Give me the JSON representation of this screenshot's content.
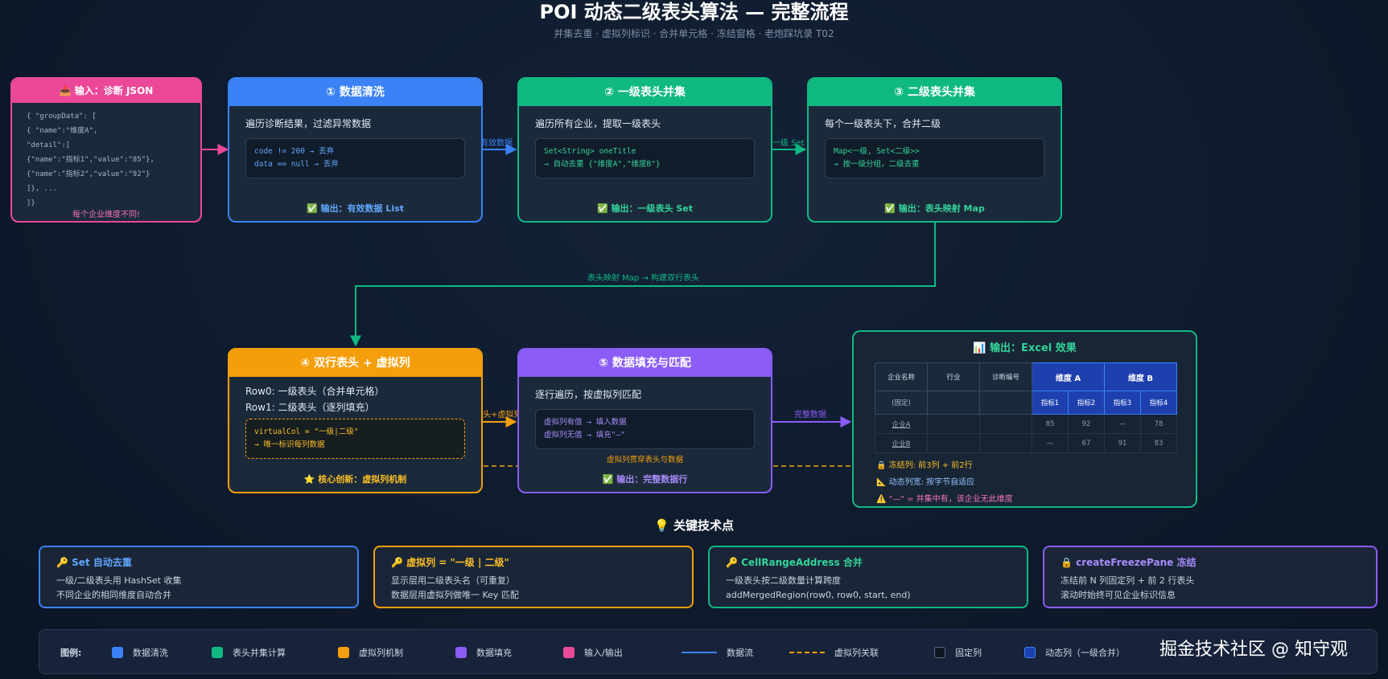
{
  "title": "POI 动态二级表头算法 — 完整流程",
  "subtitle": "并集去重 · 虚拟列标识 · 合并单元格 · 冻结窗格 · 老炮踩坑录 T02",
  "colors": {
    "pink": "#ec4899",
    "blue": "#3b82f6",
    "green": "#10b981",
    "orange": "#f59e0b",
    "purple": "#8b5cf6",
    "dark": "#0f1722",
    "navy": "#1e40af"
  },
  "input": {
    "title": "📥 输入：诊断 JSON",
    "lines": [
      "{ \"groupData\": [",
      "{ \"name\":\"维度A\",",
      "\"detail\":[",
      "{\"name\":\"指标1\",\"value\":\"85\"},",
      "{\"name\":\"指标2\",\"value\":\"92\"}",
      "]}, ...",
      "]}"
    ],
    "note": "每个企业维度不同!"
  },
  "step1": {
    "title": "① 数据清洗",
    "desc": "遍历诊断结果，过滤异常数据",
    "code": [
      "code != 200 → 丢弃",
      "data == null → 丢弃"
    ],
    "output": "✅ 输出：有效数据 List"
  },
  "step2": {
    "title": "② 一级表头并集",
    "desc": "遍历所有企业，提取一级表头",
    "code": [
      "Set<String> oneTitle",
      "→ 自动去重 {\"维度A\",\"维度B\"}"
    ],
    "output": "✅ 输出：一级表头 Set"
  },
  "step3": {
    "title": "③ 二级表头并集",
    "desc": "每个一级表头下，合并二级",
    "code": [
      "Map<一级, Set<二级>>",
      "→ 按一级分组，二级去重"
    ],
    "output": "✅ 输出：表头映射 Map"
  },
  "step4": {
    "title": "④ 双行表头 + 虚拟列",
    "desc": [
      "Row0: 一级表头（合并单元格）",
      "Row1: 二级表头（逐列填充）"
    ],
    "code": [
      "virtualCol = \"一级|二级\"",
      "→ 唯一标识每列数据"
    ],
    "output": "⭐ 核心创新：虚拟列机制"
  },
  "step5": {
    "title": "⑤ 数据填充与匹配",
    "desc": "逐行遍历，按虚拟列匹配",
    "code": [
      "虚拟列有值 → 填入数据",
      "虚拟列无值 → 填充\"—\""
    ],
    "output": "✅ 输出：完整数据行",
    "inner_note": "虚拟列贯穿表头与数据"
  },
  "arrows": {
    "a1": "有效数据",
    "a2": "一级 Set",
    "a3": "表头映射 Map → 构建双行表头",
    "a4": "表头+虚拟列",
    "a5": "完整数据"
  },
  "excel": {
    "title": "📊 输出：Excel 效果",
    "headers": [
      "企业名称",
      "行业",
      "诊断编号"
    ],
    "dims": [
      "维度 A",
      "维度 B"
    ],
    "fixed_label": "(固定)",
    "subs": [
      "指标1",
      "指标2",
      "指标3",
      "指标4"
    ],
    "rows": [
      {
        "name": "企业A",
        "v": [
          "85",
          "92",
          "—",
          "78"
        ]
      },
      {
        "name": "企业B",
        "v": [
          "—",
          "67",
          "91",
          "83"
        ]
      }
    ],
    "notes": [
      "🔒 冻结列: 前3列 + 前2行",
      "📐 动态列宽: 按字节自适应",
      "⚠️ \"—\" = 并集中有，该企业无此维度"
    ]
  },
  "key_title": "💡 关键技术点",
  "tips": [
    {
      "title": "🔑 Set 自动去重",
      "lines": [
        "一级/二级表头用 HashSet 收集",
        "不同企业的相同维度自动合并"
      ]
    },
    {
      "title": "🔑 虚拟列 = \"一级 | 二级\"",
      "lines": [
        "显示层用二级表头名（可重复）",
        "数据层用虚拟列做唯一 Key 匹配"
      ]
    },
    {
      "title": "🔑 CellRangeAddress 合并",
      "lines": [
        "一级表头按二级数量计算跨度",
        "addMergedRegion(row0, row0, start, end)"
      ]
    },
    {
      "title": "🔒 createFreezePane 冻结",
      "lines": [
        "冻结前 N 列固定列 + 前 2 行表头",
        "滚动时始终可见企业标识信息"
      ]
    }
  ],
  "legend": {
    "label": "图例:",
    "items": [
      {
        "label": "数据清洗",
        "color": "#3b82f6"
      },
      {
        "label": "表头并集计算",
        "color": "#10b981"
      },
      {
        "label": "虚拟列机制",
        "color": "#f59e0b"
      },
      {
        "label": "数据填充",
        "color": "#8b5cf6"
      },
      {
        "label": "输入/输出",
        "color": "#ec4899"
      },
      {
        "label": "数据流"
      },
      {
        "label": "虚拟列关联"
      },
      {
        "label": "固定列",
        "color": "#0f1722"
      },
      {
        "label": "动态列（一级合并）",
        "color": "#1e40af"
      }
    ]
  },
  "watermark": "掘金技术社区 @ 知守观"
}
